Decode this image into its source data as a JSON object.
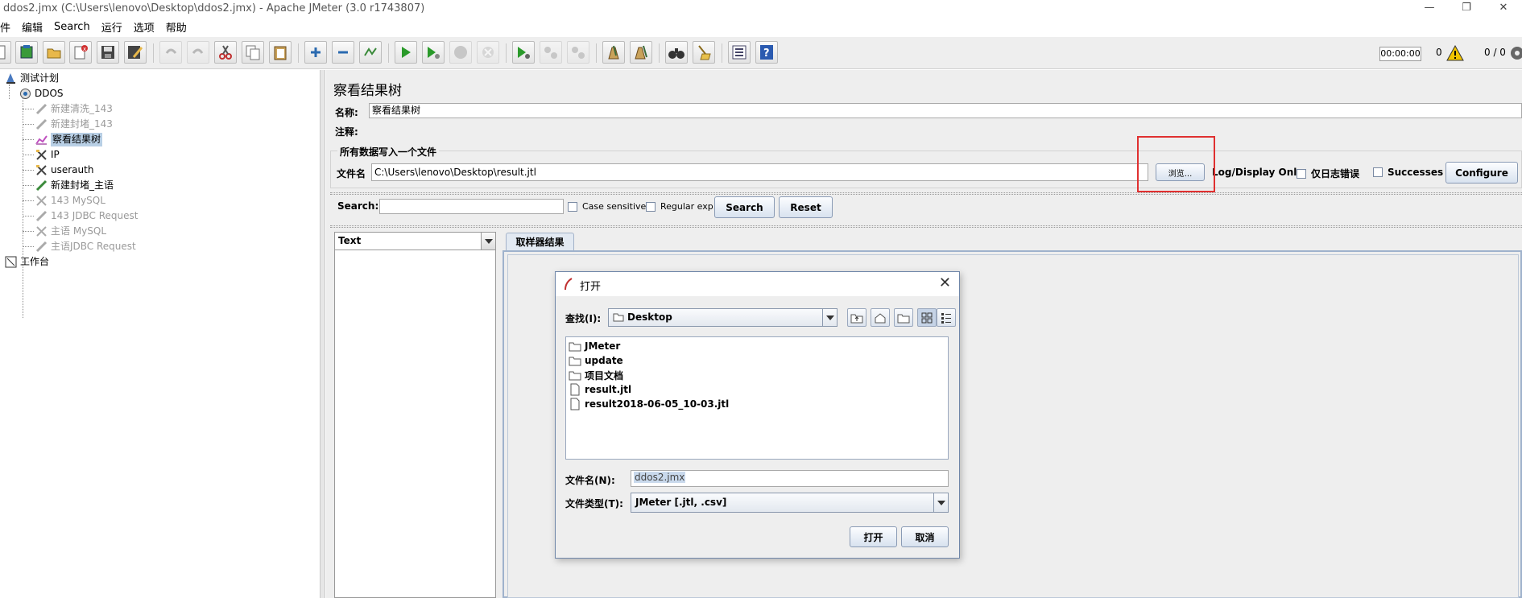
{
  "window": {
    "title": "ddos2.jmx (C:\\Users\\lenovo\\Desktop\\ddos2.jmx) - Apache JMeter (3.0 r1743807)",
    "minimize": "—",
    "restore": "❐",
    "close": "✕"
  },
  "menu": [
    "件",
    "编辑",
    "Search",
    "运行",
    "选项",
    "帮助"
  ],
  "status": {
    "timer": "00:00:00",
    "warnings": "0",
    "threads": "0 / 0"
  },
  "tree": {
    "items": [
      {
        "label": "测试计划",
        "icon": "test-plan-icon"
      },
      {
        "label": "DDOS",
        "icon": "thread-group-icon"
      },
      {
        "label": "新建清洗_143",
        "icon": "pipette-icon"
      },
      {
        "label": "新建封堵_143",
        "icon": "pipette-icon"
      },
      {
        "label": "察看结果树",
        "icon": "results-tree-icon"
      },
      {
        "label": "IP",
        "icon": "config-tools-icon"
      },
      {
        "label": "userauth",
        "icon": "config-tools-icon"
      },
      {
        "label": "新建封堵_主语",
        "icon": "pipette-icon"
      },
      {
        "label": "143 MySQL",
        "icon": "config-tools-icon"
      },
      {
        "label": "143 JDBC Request",
        "icon": "pipette-icon"
      },
      {
        "label": "主语 MySQL",
        "icon": "config-tools-icon"
      },
      {
        "label": "主语JDBC Request",
        "icon": "pipette-icon"
      },
      {
        "label": "工作台",
        "icon": "workbench-icon"
      }
    ]
  },
  "panel": {
    "title": "察看结果树",
    "name_label": "名称:",
    "name_value": "察看结果树",
    "comment_label": "注释:",
    "comment_value": "",
    "group_title": "所有数据写入一个文件",
    "file_label": "文件名",
    "file_value": "C:\\Users\\lenovo\\Desktop\\result.jtl",
    "browse_label": "浏览...",
    "log_display_label": "Log/Display Only:",
    "errors_only_label": "仅日志错误",
    "successes_label": "Successes",
    "configure_label": "Configure",
    "search_label": "Search:",
    "search_value": "",
    "case_sensitive_label": "Case sensitive",
    "regular_exp_label": "Regular exp.",
    "search_button": "Search",
    "reset_button": "Reset",
    "renderer_value": "Text",
    "tab_label": "取样器结果"
  },
  "dialog": {
    "title": "打开",
    "look_in_label": "查找(I):",
    "look_in_value": "Desktop",
    "files": [
      {
        "name": "JMeter",
        "type": "folder"
      },
      {
        "name": "update",
        "type": "folder"
      },
      {
        "name": "项目文档",
        "type": "folder"
      },
      {
        "name": "result.jtl",
        "type": "file"
      },
      {
        "name": "result2018-06-05_10-03.jtl",
        "type": "file"
      }
    ],
    "file_name_label": "文件名(N):",
    "file_name_value": "ddos2.jmx",
    "file_type_label": "文件类型(T):",
    "file_type_value": "JMeter [.jtl, .csv]",
    "open_button": "打开",
    "cancel_button": "取消"
  }
}
